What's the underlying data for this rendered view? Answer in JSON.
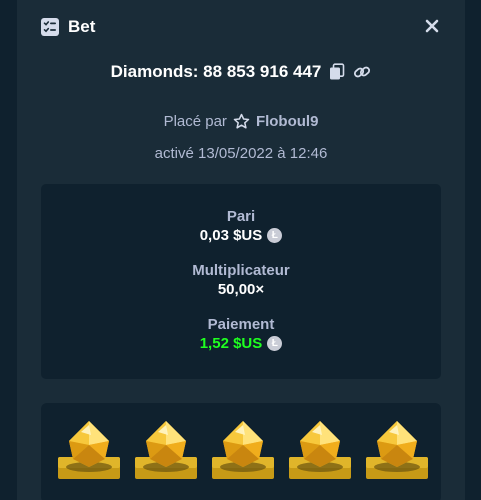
{
  "modal": {
    "title": "Bet",
    "title_icon": "bet-slip-icon",
    "close_icon": "close-icon"
  },
  "game": {
    "label": "Diamonds: 88 853 916 447",
    "copy_icon": "copy-icon",
    "link_icon": "link-icon"
  },
  "placed": {
    "prefix": "Placé par",
    "user": "Floboul9",
    "user_icon": "star-icon"
  },
  "date": "activé 13/05/2022 à 12:46",
  "stats": {
    "bet_label": "Pari",
    "bet_value": "0,03 $US",
    "multiplier_label": "Multiplicateur",
    "multiplier_value": "50,00×",
    "payout_label": "Paiement",
    "payout_value": "1,52 $US",
    "currency_icon": "litecoin-icon"
  },
  "board": {
    "tiles": [
      "yellow-gem",
      "yellow-gem",
      "yellow-gem",
      "yellow-gem",
      "yellow-gem"
    ]
  },
  "colors": {
    "background": "#1a2c38",
    "panel": "#0f212e",
    "muted_text": "#b1bad3",
    "win": "#1fff20",
    "gem": "#f5c23a"
  }
}
